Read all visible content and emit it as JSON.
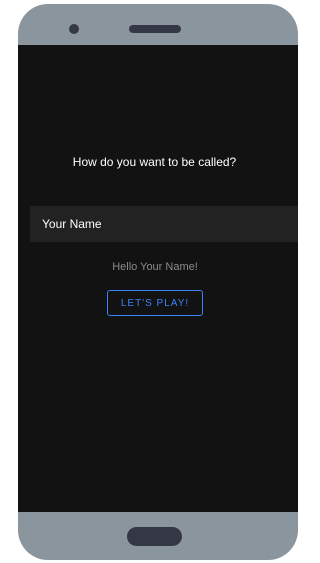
{
  "screen": {
    "prompt": "How do you want to be called?",
    "name_input": {
      "value": "Your Name",
      "placeholder": ""
    },
    "greeting": "Hello Your Name!",
    "play_button_label": "LET'S PLAY!"
  },
  "colors": {
    "phone_frame": "#8a959d",
    "screen_background": "#121212",
    "input_background": "#222222",
    "accent": "#3b82f6",
    "muted_text": "#8b8b8b"
  }
}
